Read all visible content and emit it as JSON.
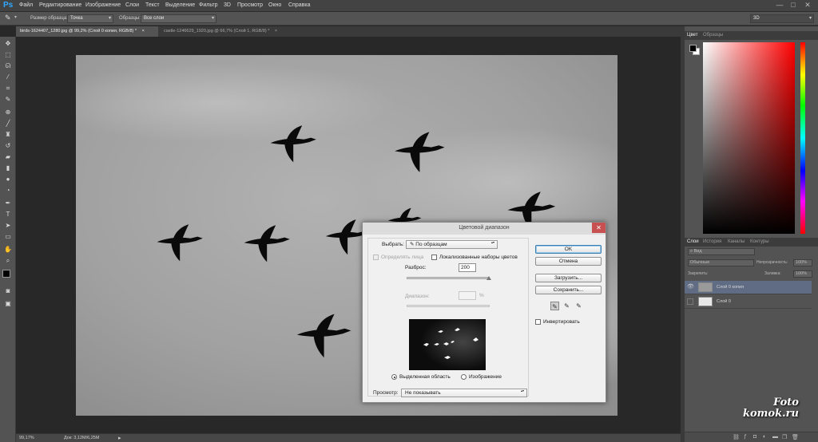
{
  "menubar": {
    "logo": "Ps",
    "items": [
      "Файл",
      "Редактирование",
      "Изображение",
      "Слои",
      "Текст",
      "Выделение",
      "Фильтр",
      "3D",
      "Просмотр",
      "Окно",
      "Справка"
    ],
    "window_controls": [
      "—",
      "□",
      "✕"
    ]
  },
  "options": {
    "sample_size_label": "Размер образца:",
    "sample_size_value": "Точка",
    "sample_label": "Образцы:",
    "sample_value": "Все слои",
    "workspace": "3D"
  },
  "tabs": [
    {
      "label": "birds-1624407_1280.jpg @ 99,2% (Слой 0 копия, RGB/8) *",
      "close": "×",
      "active": true
    },
    {
      "label": "castle-1246629_1920.jpg @ 66,7% (Слой 1, RGB/8) *",
      "close": "×",
      "active": false
    }
  ],
  "status": {
    "zoom": "99,17%",
    "doc": "Док: 3,12M/6,25M",
    "arrow": "▸"
  },
  "panels": {
    "color_tabs": [
      "Цвет",
      "Образцы"
    ],
    "layers_tabs": [
      "Слои",
      "История",
      "Каналы",
      "Контуры"
    ],
    "kind_select": "Вид",
    "blend_mode": "Обычные",
    "opacity_label": "Непрозрачность:",
    "opacity_value": "100%",
    "lock_label": "Закрепить:",
    "fill_label": "Заливка:",
    "fill_value": "100%",
    "layers": [
      {
        "name": "Слой 0 копия",
        "visible": true,
        "selected": true
      },
      {
        "name": "Слой 0",
        "visible": false,
        "selected": false
      }
    ]
  },
  "dialog": {
    "title": "Цветовой диапазон",
    "select_label": "Выбрать:",
    "select_value": "По образцам",
    "detect_faces": "Определять лица",
    "localized": "Локализованные наборы цветов",
    "fuzziness_label": "Разброс:",
    "fuzziness_value": "200",
    "fuzziness": 1.0,
    "range_label": "Диапазон:",
    "range_unit": "%",
    "buttons": {
      "ok": "OK",
      "cancel": "Отмена",
      "load": "Загрузить...",
      "save": "Сохранить..."
    },
    "invert": "Инвертировать",
    "radio_selection": "Выделенная область",
    "radio_image": "Изображение",
    "preview_label": "Просмотр:",
    "preview_value": "Не показывать"
  },
  "watermark": {
    "line1": "Foto",
    "line2": "komok.ru"
  },
  "colors": {
    "accent": "#31a8ff",
    "selected_layer": "#5f6c84",
    "close_red": "#c75050"
  }
}
